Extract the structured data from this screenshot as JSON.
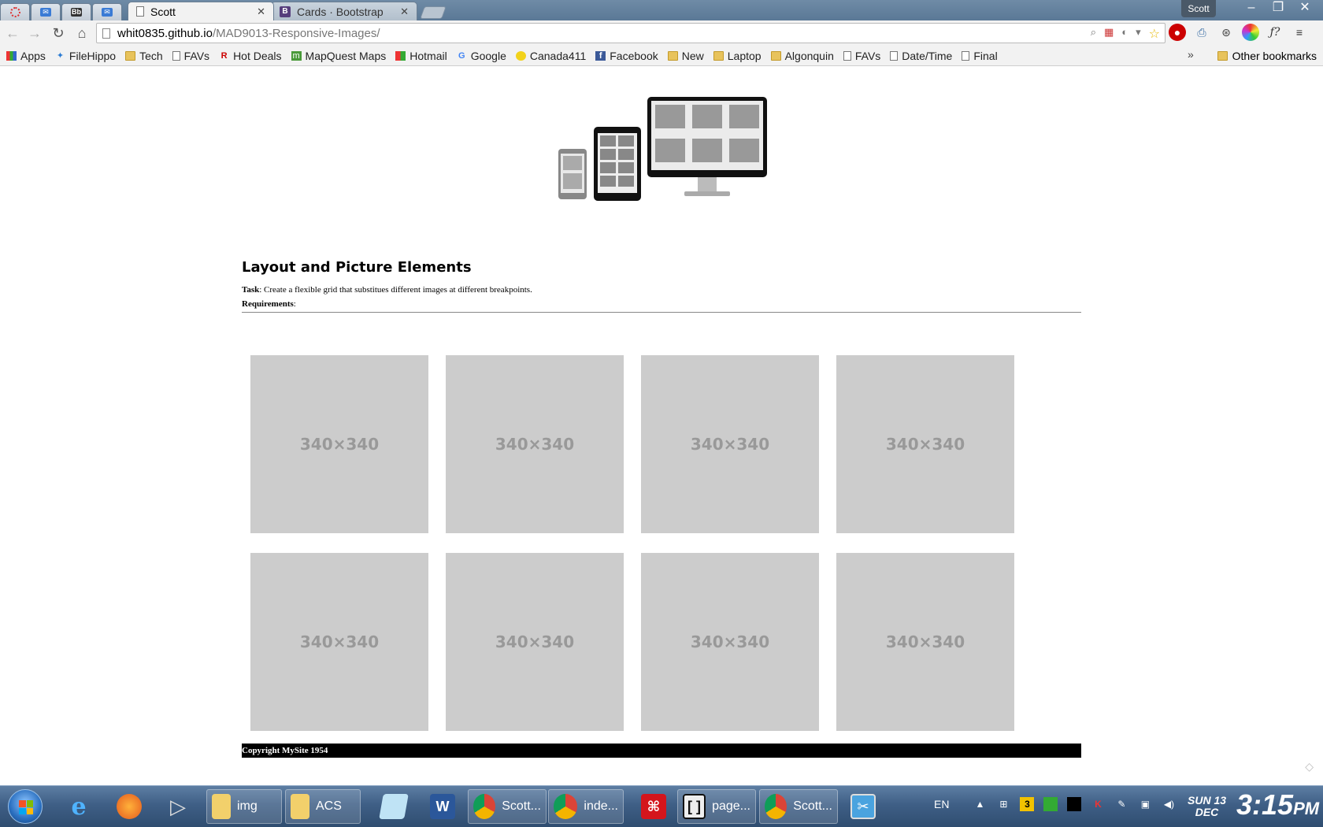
{
  "browser": {
    "profile_name": "Scott",
    "tabs": [
      {
        "title": "Scott",
        "active": true
      },
      {
        "title": "Cards · Bootstrap",
        "active": false
      }
    ],
    "pinned_tabs": [
      "opera-icon",
      "mail-icon",
      "blackboard-icon",
      "mail-icon"
    ],
    "pinned_tab_labels": [
      "",
      "",
      "Bb",
      ""
    ],
    "url_host": "whit0835.github.io",
    "url_path": "/MAD9013-Responsive-Images/",
    "bookmarks": [
      {
        "label": "Apps",
        "icon": "apps-icon"
      },
      {
        "label": "FileHippo",
        "icon": "filehippo-icon"
      },
      {
        "label": "Tech",
        "icon": "folder-icon"
      },
      {
        "label": "FAVs",
        "icon": "page-icon"
      },
      {
        "label": "Hot Deals",
        "icon": "hotdeals-icon"
      },
      {
        "label": "MapQuest Maps",
        "icon": "mapquest-icon"
      },
      {
        "label": "Hotmail",
        "icon": "windows-icon"
      },
      {
        "label": "Google",
        "icon": "google-icon"
      },
      {
        "label": "Canada411",
        "icon": "canada411-icon"
      },
      {
        "label": "Facebook",
        "icon": "facebook-icon"
      },
      {
        "label": "New",
        "icon": "folder-icon"
      },
      {
        "label": "Laptop",
        "icon": "folder-icon"
      },
      {
        "label": "Algonquin",
        "icon": "folder-icon"
      },
      {
        "label": "FAVs",
        "icon": "page-icon"
      },
      {
        "label": "Date/Time",
        "icon": "page-icon"
      },
      {
        "label": "Final",
        "icon": "page-icon"
      }
    ],
    "overflow_label": "»",
    "other_bookmarks": "Other bookmarks"
  },
  "page": {
    "heading": "Layout and Picture Elements",
    "task_label": "Task",
    "task_text": ": Create a flexible grid that substitues different images at different breakpoints.",
    "requirements_label": "Requirements",
    "requirements_text": ":",
    "tiles": [
      "340×340",
      "340×340",
      "340×340",
      "340×340",
      "340×340",
      "340×340",
      "340×340",
      "340×340"
    ],
    "footer": "Copyright MySite 1954"
  },
  "taskbar": {
    "items": [
      {
        "label": "",
        "icon": "ie-icon"
      },
      {
        "label": "",
        "icon": "firefox-icon"
      },
      {
        "label": "",
        "icon": "media-player-icon"
      },
      {
        "label": "img",
        "icon": "folder-icon"
      },
      {
        "label": "ACS",
        "icon": "folder-icon"
      },
      {
        "label": "",
        "icon": "notepad-icon"
      },
      {
        "label": "",
        "icon": "word-icon"
      },
      {
        "label": "Scott...",
        "icon": "chrome-icon"
      },
      {
        "label": "inde...",
        "icon": "chrome-icon"
      },
      {
        "label": "",
        "icon": "acrobat-icon"
      },
      {
        "label": "page...",
        "icon": "brackets-icon"
      },
      {
        "label": "Scott...",
        "icon": "chrome-icon"
      },
      {
        "label": "",
        "icon": "snipping-icon"
      }
    ],
    "language": "EN",
    "tray_badge": "3",
    "clock_day": "SUN",
    "clock_date": "13",
    "clock_month": "DEC",
    "clock_time": "3:15",
    "clock_ampm": "PM"
  },
  "colors": {
    "tile_bg": "#cccccc",
    "tile_text": "#999999",
    "footer_bg": "#000000",
    "footer_text": "#ffffff"
  }
}
